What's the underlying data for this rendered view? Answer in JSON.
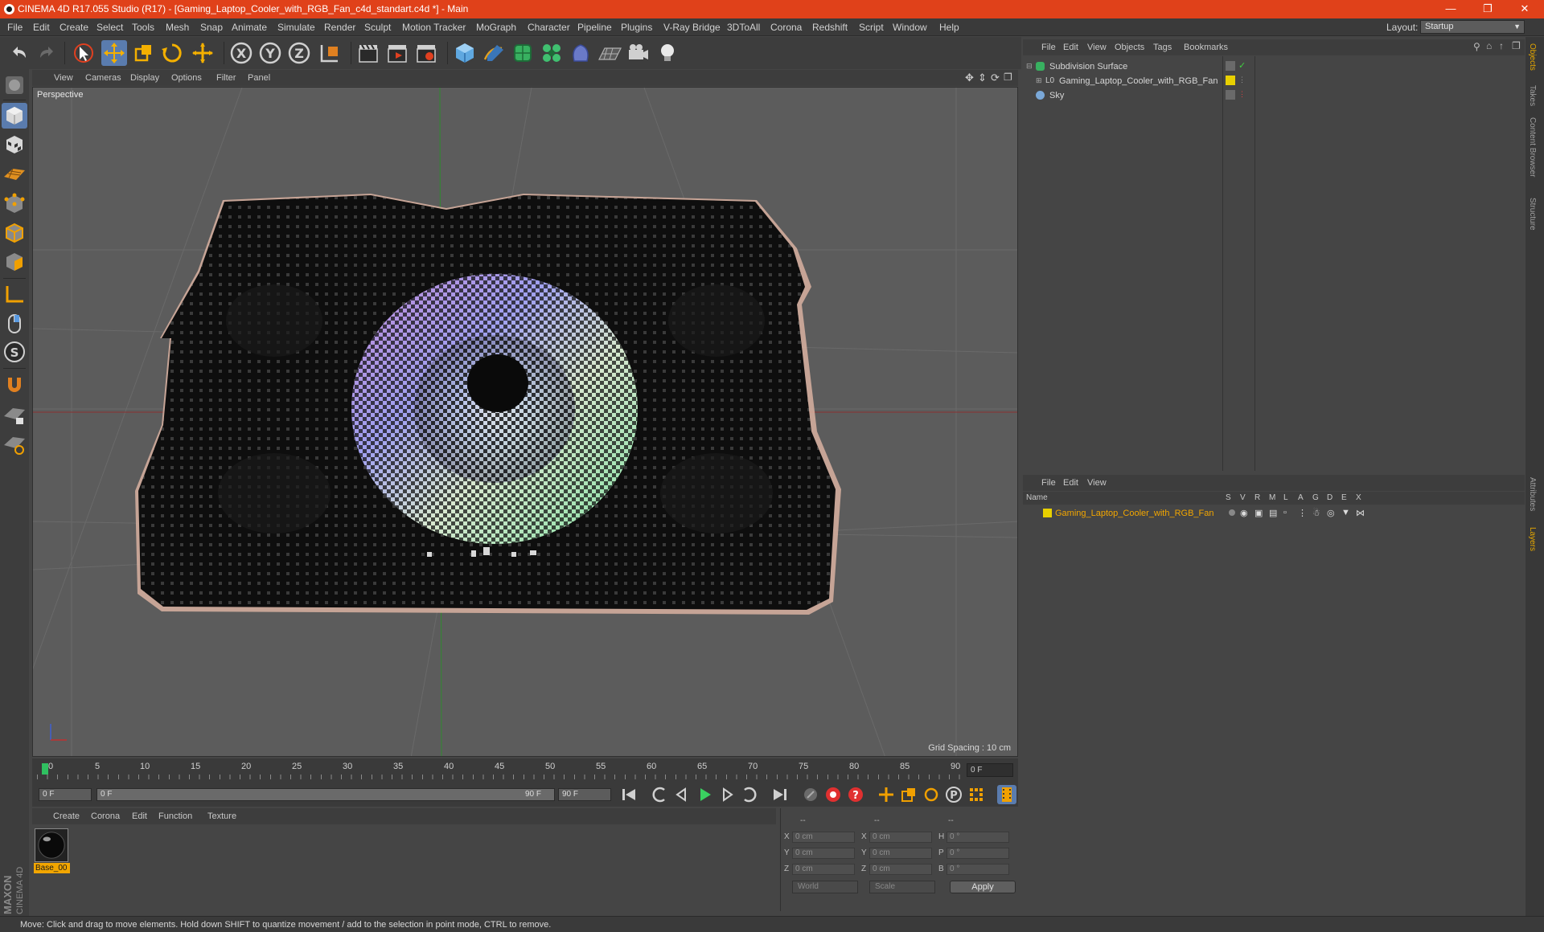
{
  "window": {
    "title": "CINEMA 4D R17.055 Studio (R17) - [Gaming_Laptop_Cooler_with_RGB_Fan_c4d_standart.c4d *] - Main",
    "controls": [
      "minimize",
      "restore",
      "close"
    ]
  },
  "menu": {
    "items": [
      "File",
      "Edit",
      "Create",
      "Select",
      "Tools",
      "Mesh",
      "Snap",
      "Animate",
      "Simulate",
      "Render",
      "Sculpt",
      "Motion Tracker",
      "MoGraph",
      "Character",
      "Pipeline",
      "Plugins",
      "V-Ray Bridge",
      "3DToAll",
      "Corona",
      "Redshift",
      "Script",
      "Window",
      "Help"
    ],
    "layout_label": "Layout:",
    "layout_value": "Startup"
  },
  "viewport": {
    "menu": [
      "View",
      "Cameras",
      "Display",
      "Options",
      "Filter",
      "Panel"
    ],
    "label": "Perspective",
    "grid_spacing": "Grid Spacing : 10 cm"
  },
  "timeline": {
    "ticks": [
      "0",
      "5",
      "10",
      "15",
      "20",
      "25",
      "30",
      "35",
      "40",
      "45",
      "50",
      "55",
      "60",
      "65",
      "70",
      "75",
      "80",
      "85",
      "90"
    ],
    "current_frame": "0 F",
    "start_field": "0 F",
    "range_start": "0 F",
    "range_end": "90 F",
    "end_field": "90 F"
  },
  "materials": {
    "menu": [
      "Create",
      "Corona",
      "Edit",
      "Function",
      "Texture"
    ],
    "items": [
      {
        "name": "Base_00"
      }
    ]
  },
  "coordinates": {
    "header": [
      "--",
      "--",
      "--"
    ],
    "rows": [
      {
        "a": "X",
        "pos": "0 cm",
        "b": "X",
        "size": "0 cm",
        "c": "H",
        "rot": "0 °"
      },
      {
        "a": "Y",
        "pos": "0 cm",
        "b": "Y",
        "size": "0 cm",
        "c": "P",
        "rot": "0 °"
      },
      {
        "a": "Z",
        "pos": "0 cm",
        "b": "Z",
        "size": "0 cm",
        "c": "B",
        "rot": "0 °"
      }
    ],
    "mode": "World",
    "transform": "Scale",
    "apply": "Apply"
  },
  "objects": {
    "menu": [
      "File",
      "Edit",
      "View",
      "Objects",
      "Tags",
      "Bookmarks"
    ],
    "tree": [
      {
        "name": "Subdivision Surface",
        "icon": "subdivision-icon"
      },
      {
        "name": "Gaming_Laptop_Cooler_with_RGB_Fan",
        "icon": "null-object-icon"
      },
      {
        "name": "Sky",
        "icon": "sky-icon"
      }
    ]
  },
  "layers": {
    "menu": [
      "File",
      "Edit",
      "View"
    ],
    "columns": [
      "Name",
      "S",
      "V",
      "R",
      "M",
      "L",
      "A",
      "G",
      "D",
      "E",
      "X"
    ],
    "items": [
      {
        "name": "Gaming_Laptop_Cooler_with_RGB_Fan",
        "color": "#e8d000"
      }
    ]
  },
  "right_tabs": [
    "Objects",
    "Takes",
    "Content Browser",
    "Structure",
    "Attributes",
    "Layers"
  ],
  "status": "Move: Click and drag to move elements. Hold down SHIFT to quantize movement / add to the selection in point mode, CTRL to remove.",
  "branding": "MAXON CINEMA 4D",
  "colors": {
    "title_bar": "#e0411a",
    "accent": "#f2a600",
    "active_tool": "#5a7cae"
  }
}
